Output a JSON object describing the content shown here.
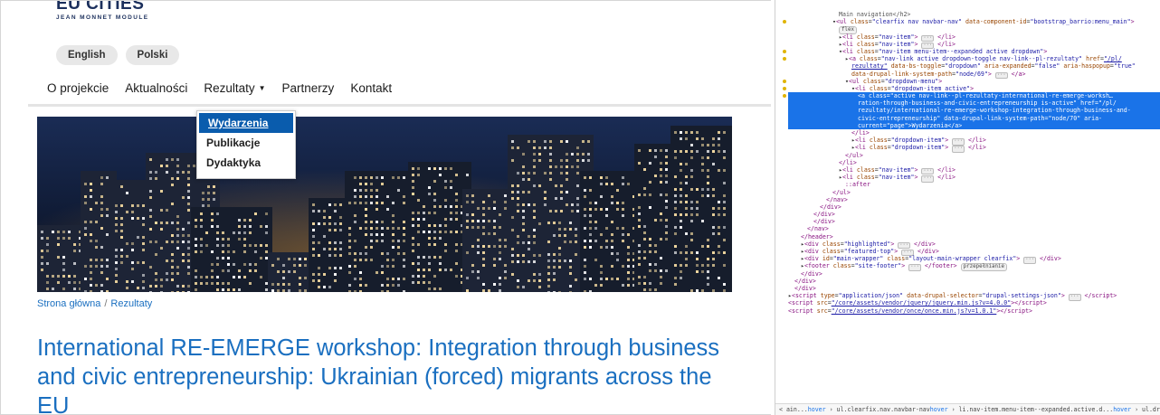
{
  "site": {
    "logo_main": "EU CITIES",
    "logo_sub": "JEAN MONNET MODULE",
    "languages": [
      "English",
      "Polski"
    ],
    "nav": [
      {
        "label": "O projekcie"
      },
      {
        "label": "Aktualności"
      },
      {
        "label": "Rezultaty",
        "dropdown": true
      },
      {
        "label": "Partnerzy"
      },
      {
        "label": "Kontakt"
      }
    ],
    "dropdown_items": [
      {
        "label": "Wydarzenia",
        "active": true
      },
      {
        "label": "Publikacje",
        "active": false
      },
      {
        "label": "Dydaktyka",
        "active": false
      }
    ],
    "breadcrumb": {
      "home": "Strona główna",
      "sep": "/",
      "current": "Rezultaty"
    },
    "title": "International RE-EMERGE workshop: Integration through business and civic entrepreneurship: Ukrainian (forced) migrants across the EU",
    "colors": {
      "link": "#1a6fc0",
      "active_bg": "#0a5cad",
      "logo": "#1b2f5c"
    }
  },
  "devtools": {
    "lines": [
      {
        "indent": 7,
        "html": "<span class='cm'>Main navigation&lt;/h2&gt;</span>"
      },
      {
        "indent": 6,
        "dot": true,
        "html": "▾<span class='tg'>&lt;ul</span> <span class='an'>class</span>=<span class='av'>\"clearfix nav navbar-nav\"</span> <span class='an'>data-component-id</span>=<span class='av'>\"bootstrap_barrio:menu_main\"</span><span class='tg'>&gt;</span>"
      },
      {
        "indent": 7,
        "html": "<span class='badge'>flex</span>"
      },
      {
        "indent": 7,
        "html": "▸<span class='tg'>&lt;li</span> <span class='an'>class</span>=<span class='av'>\"nav-item\"</span><span class='tg'>&gt;</span> <span class='ell'>···</span> <span class='tg'>&lt;/li&gt;</span>"
      },
      {
        "indent": 7,
        "html": "▸<span class='tg'>&lt;li</span> <span class='an'>class</span>=<span class='av'>\"nav-item\"</span><span class='tg'>&gt;</span> <span class='ell'>···</span> <span class='tg'>&lt;/li&gt;</span>"
      },
      {
        "indent": 7,
        "dot": true,
        "html": "▾<span class='tg'>&lt;li</span> <span class='an'>class</span>=<span class='av'>\"nav-item menu-item--expanded active dropdown\"</span><span class='tg'>&gt;</span>"
      },
      {
        "indent": 8,
        "dot": true,
        "html": "▸<span class='tg'>&lt;a</span> <span class='an'>class</span>=<span class='av'>\"nav-link active dropdown-toggle nav-link--pl-rezultaty\"</span> <span class='an'>href</span>=<span class='ln'>\"/pl/</span>"
      },
      {
        "indent": 9,
        "html": "<span class='ln'>rezultaty\"</span> <span class='an'>data-bs-toggle</span>=<span class='av'>\"dropdown\"</span> <span class='an'>aria-expanded</span>=<span class='av'>\"false\"</span> <span class='an'>aria-haspopup</span>=<span class='av'>\"true\"</span>"
      },
      {
        "indent": 9,
        "html": "<span class='an'>data-drupal-link-system-path</span>=<span class='av'>\"node/69\"</span><span class='tg'>&gt;</span> <span class='ell'>···</span> <span class='tg'>&lt;/a&gt;</span>"
      },
      {
        "indent": 8,
        "dot": true,
        "html": "▾<span class='tg'>&lt;ul</span> <span class='an'>class</span>=<span class='av'>\"dropdown-menu\"</span><span class='tg'>&gt;</span>"
      },
      {
        "indent": 9,
        "dot": true,
        "html": "▾<span class='tg'>&lt;li</span> <span class='an'>class</span>=<span class='av'>\"dropdown-item active\"</span><span class='tg'>&gt;</span>"
      },
      {
        "indent": 10,
        "sel": true,
        "dot": true,
        "html": "<span class='tg'>&lt;a</span> <span class='an'>class</span>=<span class='av'>\"active nav-link--pl-rezultaty-international-re-emerge-worksh…</span>"
      },
      {
        "indent": 10,
        "sel": true,
        "html": "<span class='av'>ration-through-business-and-civic-entrepreneurship is-active\"</span> <span class='an'>href</span>=<span class='av'>\"/pl/</span>"
      },
      {
        "indent": 10,
        "sel": true,
        "html": "<span class='av'>rezultaty/international-re-emerge-workshop-integration-through-business-and-</span>"
      },
      {
        "indent": 10,
        "sel": true,
        "html": "<span class='av'>civic-entrepreneurship\"</span> <span class='an'>data-drupal-link-system-path</span>=<span class='av'>\"node/70\"</span> <span class='an'>aria-</span>"
      },
      {
        "indent": 10,
        "sel": true,
        "html": "<span class='an'>current</span>=<span class='av'>\"page\"</span><span class='tg'>&gt;</span>Wydarzenia<span class='tg'>&lt;/a&gt;</span>"
      },
      {
        "indent": 9,
        "html": "<span class='tg'>&lt;/li&gt;</span>"
      },
      {
        "indent": 9,
        "html": "▸<span class='tg'>&lt;li</span> <span class='an'>class</span>=<span class='av'>\"dropdown-item\"</span><span class='tg'>&gt;</span> <span class='ell'>···</span> <span class='tg'>&lt;/li&gt;</span>"
      },
      {
        "indent": 9,
        "html": "▸<span class='tg'>&lt;li</span> <span class='an'>class</span>=<span class='av'>\"dropdown-item\"</span><span class='tg'>&gt;</span> <span class='ell'>···</span> <span class='tg'>&lt;/li&gt;</span>"
      },
      {
        "indent": 8,
        "html": "<span class='tg'>&lt;/ul&gt;</span>"
      },
      {
        "indent": 7,
        "html": "<span class='tg'>&lt;/li&gt;</span>"
      },
      {
        "indent": 7,
        "html": "▸<span class='tg'>&lt;li</span> <span class='an'>class</span>=<span class='av'>\"nav-item\"</span><span class='tg'>&gt;</span> <span class='ell'>···</span> <span class='tg'>&lt;/li&gt;</span>"
      },
      {
        "indent": 7,
        "html": "▸<span class='tg'>&lt;li</span> <span class='an'>class</span>=<span class='av'>\"nav-item\"</span><span class='tg'>&gt;</span> <span class='ell'>···</span> <span class='tg'>&lt;/li&gt;</span>"
      },
      {
        "indent": 8,
        "html": "<span class='tg'>::after</span>"
      },
      {
        "indent": 6,
        "html": "<span class='tg'>&lt;/ul&gt;</span>"
      },
      {
        "indent": 5,
        "html": "<span class='tg'>&lt;/nav&gt;</span>"
      },
      {
        "indent": 4,
        "html": "<span class='tg'>&lt;/div&gt;</span>"
      },
      {
        "indent": 3,
        "html": "<span class='tg'>&lt;/div&gt;</span>"
      },
      {
        "indent": 3,
        "html": "<span class='tg'>&lt;/div&gt;</span>"
      },
      {
        "indent": 2,
        "html": "<span class='tg'>&lt;/nav&gt;</span>"
      },
      {
        "indent": 1,
        "html": "<span class='tg'>&lt;/header&gt;</span>"
      },
      {
        "indent": 1,
        "html": "▸<span class='tg'>&lt;div</span> <span class='an'>class</span>=<span class='av'>\"highlighted\"</span><span class='tg'>&gt;</span> <span class='ell'>···</span> <span class='tg'>&lt;/div&gt;</span>"
      },
      {
        "indent": 1,
        "html": "▸<span class='tg'>&lt;div</span> <span class='an'>class</span>=<span class='av'>\"featured-top\"</span><span class='tg'>&gt;</span> <span class='ell'>···</span> <span class='tg'>&lt;/div&gt;</span>"
      },
      {
        "indent": 1,
        "html": "▸<span class='tg'>&lt;div</span> <span class='an'>id</span>=<span class='av'>\"main-wrapper\"</span> <span class='an'>class</span>=<span class='av'>\"layout-main-wrapper clearfix\"</span><span class='tg'>&gt;</span> <span class='ell'>···</span> <span class='tg'>&lt;/div&gt;</span>"
      },
      {
        "indent": 1,
        "html": "▸<span class='tg'>&lt;footer</span> <span class='an'>class</span>=<span class='av'>\"site-footer\"</span><span class='tg'>&gt;</span> <span class='ell'>···</span> <span class='tg'>&lt;/footer&gt;</span> <span class='badge'>przepełnianie</span>"
      },
      {
        "indent": 1,
        "html": "<span class='tg'>&lt;/div&gt;</span>"
      },
      {
        "indent": 0,
        "html": "<span class='tg'>&lt;/div&gt;</span>"
      },
      {
        "indent": 0,
        "html": "<span class='tg'>&lt;/div&gt;</span>"
      },
      {
        "indent": -1,
        "html": "▸<span class='tg'>&lt;script</span> <span class='an'>type</span>=<span class='av'>\"application/json\"</span> <span class='an'>data-drupal-selector</span>=<span class='av'>\"drupal-settings-json\"</span><span class='tg'>&gt;</span> <span class='ell'>···</span> <span class='tg'>&lt;/script&gt;</span>"
      },
      {
        "indent": -1,
        "html": "<span class='tg'>&lt;script</span> <span class='an'>src</span>=<span class='ln'>\"/core/assets/vendor/jquery/jquery.min.js?v=4.0.0\"</span><span class='tg'>&gt;&lt;/script&gt;</span>"
      },
      {
        "indent": -1,
        "html": "<span class='tg'>&lt;script</span> <span class='an'>src</span>=<span class='ln'>\"/core/assets/vendor/once/once.min.js?v=1.0.1\"</span><span class='tg'>&gt;&lt;/script&gt;</span>"
      }
    ],
    "breadcrumbs_bar": "&lt; ain...<span class='hov'>hover</span> › ul.clearfix.nav.navbar-nav<span class='hov'>hover</span> › li.nav-item.menu-item--expanded.active.d...<span class='hov'>hover</span> › ul.dropdown-men"
  }
}
